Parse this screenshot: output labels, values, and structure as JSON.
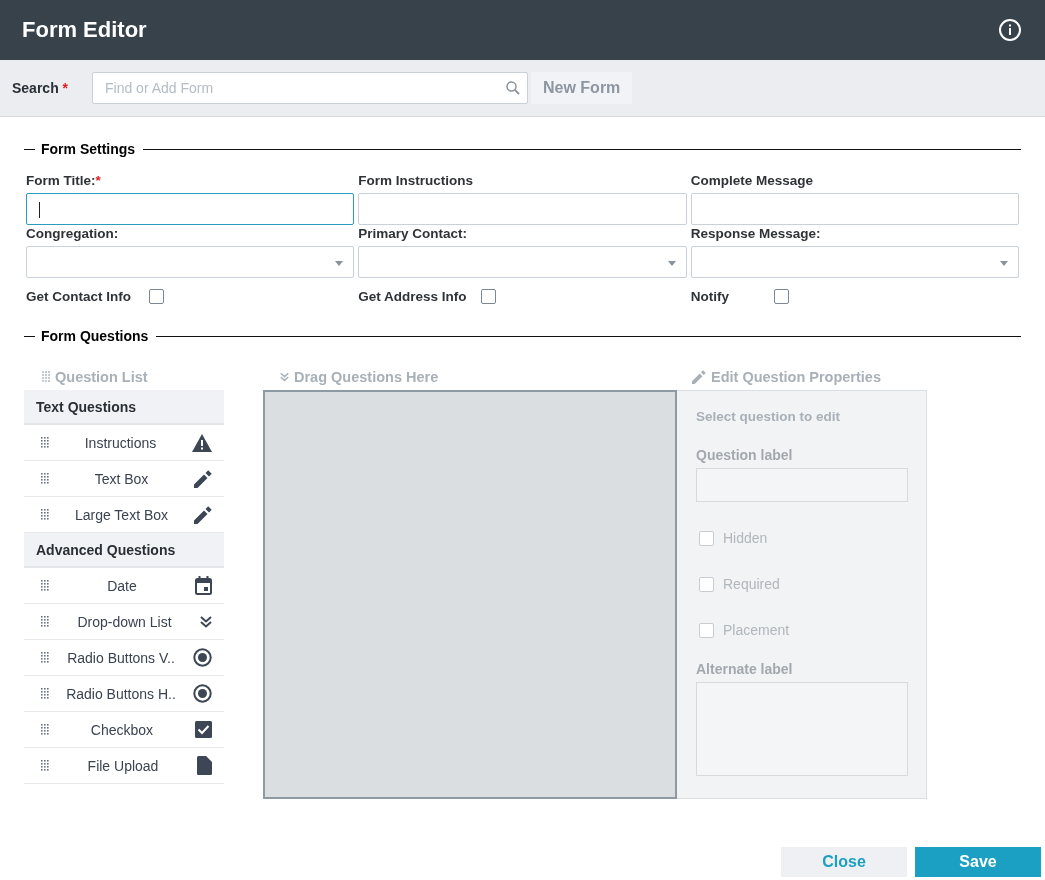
{
  "window": {
    "title": "Form Editor"
  },
  "search": {
    "label": "Search",
    "required_mark": "*",
    "placeholder": "Find or Add Form",
    "new_button": "New Form"
  },
  "form_settings": {
    "title": "Form Settings",
    "fields": [
      {
        "label": "Form Title:",
        "required": true,
        "kind": "text",
        "focused": true
      },
      {
        "label": "Form Instructions",
        "required": false,
        "kind": "text",
        "focused": false
      },
      {
        "label": "Complete Message",
        "required": false,
        "kind": "text",
        "focused": false
      },
      {
        "label": "Congregation:",
        "required": false,
        "kind": "select",
        "focused": false
      },
      {
        "label": "Primary Contact:",
        "required": false,
        "kind": "select",
        "focused": false
      },
      {
        "label": "Response Message:",
        "required": false,
        "kind": "select",
        "focused": false
      }
    ],
    "checkboxes": [
      {
        "label": "Get Contact Info",
        "checked": false
      },
      {
        "label": "Get Address Info",
        "checked": false
      },
      {
        "label": "Notify",
        "checked": false
      }
    ]
  },
  "form_questions": {
    "title": "Form Questions",
    "question_list": {
      "title": "Question List",
      "groups": [
        {
          "title": "Text Questions",
          "items": [
            {
              "label": "Instructions",
              "kind": "warning"
            },
            {
              "label": "Text Box",
              "kind": "pencil"
            },
            {
              "label": "Large Text Box",
              "kind": "pencil"
            }
          ]
        },
        {
          "title": "Advanced Questions",
          "items": [
            {
              "label": "Date",
              "kind": "calendar"
            },
            {
              "label": "Drop-down List",
              "kind": "chevrons"
            },
            {
              "label": "Radio Buttons V..",
              "kind": "radio"
            },
            {
              "label": "Radio Buttons H..",
              "kind": "radio"
            },
            {
              "label": "Checkbox",
              "kind": "checkbox"
            },
            {
              "label": "File Upload",
              "kind": "file"
            }
          ]
        }
      ]
    },
    "drop_area": {
      "title": "Drag Questions Here"
    },
    "properties": {
      "title": "Edit Question Properties",
      "hint": "Select question to edit",
      "label_field": "Question label",
      "checkboxes": [
        {
          "label": "Hidden",
          "checked": false
        },
        {
          "label": "Required",
          "checked": false
        },
        {
          "label": "Placement",
          "checked": false
        }
      ],
      "alternate_label": "Alternate label"
    }
  },
  "buttons": {
    "close": "Close",
    "save": "Save"
  }
}
